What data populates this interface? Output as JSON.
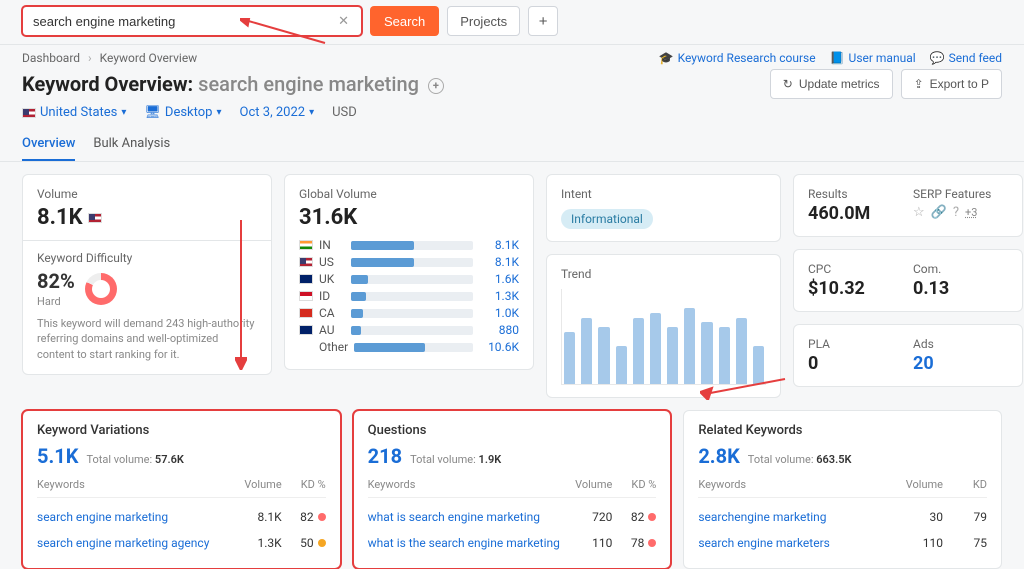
{
  "search": {
    "value": "search engine marketing",
    "button": "Search",
    "projects": "Projects"
  },
  "breadcrumb": [
    "Dashboard",
    "Keyword Overview"
  ],
  "headerLinks": {
    "course": "Keyword Research course",
    "manual": "User manual",
    "feedback": "Send feed"
  },
  "title": {
    "prefix": "Keyword Overview:",
    "keyword": "search engine marketing"
  },
  "actions": {
    "update": "Update metrics",
    "export": "Export to P"
  },
  "filters": {
    "country": "United States",
    "device": "Desktop",
    "date": "Oct 3, 2022",
    "currency": "USD"
  },
  "tabs": [
    "Overview",
    "Bulk Analysis"
  ],
  "volume": {
    "label": "Volume",
    "value": "8.1K"
  },
  "kd": {
    "label": "Keyword Difficulty",
    "value": "82%",
    "level": "Hard",
    "note": "This keyword will demand 243 high-authority referring domains and well-optimized content to start ranking for it."
  },
  "globalVolume": {
    "label": "Global Volume",
    "value": "31.6K",
    "rows": [
      {
        "flag": "in",
        "cc": "IN",
        "pct": 52,
        "val": "8.1K"
      },
      {
        "flag": "us",
        "cc": "US",
        "pct": 52,
        "val": "8.1K"
      },
      {
        "flag": "uk",
        "cc": "UK",
        "pct": 14,
        "val": "1.6K"
      },
      {
        "flag": "id",
        "cc": "ID",
        "pct": 12,
        "val": "1.3K"
      },
      {
        "flag": "ca",
        "cc": "CA",
        "pct": 10,
        "val": "1.0K"
      },
      {
        "flag": "au",
        "cc": "AU",
        "pct": 8,
        "val": "880"
      }
    ],
    "other": {
      "cc": "Other",
      "pct": 60,
      "val": "10.6K"
    }
  },
  "intent": {
    "label": "Intent",
    "badge": "Informational"
  },
  "trend": {
    "label": "Trend",
    "bars": [
      55,
      70,
      60,
      40,
      70,
      75,
      60,
      80,
      65,
      60,
      70,
      40
    ]
  },
  "results": {
    "label": "Results",
    "value": "460.0M"
  },
  "serp": {
    "label": "SERP Features",
    "more": "+3"
  },
  "cpc": {
    "label": "CPC",
    "value": "$10.32"
  },
  "com": {
    "label": "Com.",
    "value": "0.13"
  },
  "pla": {
    "label": "PLA",
    "value": "0"
  },
  "ads": {
    "label": "Ads",
    "value": "20"
  },
  "variations": {
    "title": "Keyword Variations",
    "count": "5.1K",
    "tvLabel": "Total volume:",
    "tv": "57.6K",
    "cols": [
      "Keywords",
      "Volume",
      "KD %"
    ],
    "rows": [
      {
        "kw": "search engine marketing",
        "vol": "8.1K",
        "kd": "82",
        "dot": "#ff6b6b"
      },
      {
        "kw": "search engine marketing agency",
        "vol": "1.3K",
        "kd": "50",
        "dot": "#f5a623"
      }
    ]
  },
  "questions": {
    "title": "Questions",
    "count": "218",
    "tvLabel": "Total volume:",
    "tv": "1.9K",
    "cols": [
      "Keywords",
      "Volume",
      "KD %"
    ],
    "rows": [
      {
        "kw": "what is search engine marketing",
        "vol": "720",
        "kd": "82",
        "dot": "#ff6b6b"
      },
      {
        "kw": "what is the search engine marketing",
        "vol": "110",
        "kd": "78",
        "dot": "#ff6b6b"
      }
    ]
  },
  "related": {
    "title": "Related Keywords",
    "count": "2.8K",
    "tvLabel": "Total volume:",
    "tv": "663.5K",
    "cols": [
      "Keywords",
      "Volume",
      "KD"
    ],
    "rows": [
      {
        "kw": "searchengine marketing",
        "vol": "30",
        "kd": "79"
      },
      {
        "kw": "search engine marketers",
        "vol": "110",
        "kd": "75"
      }
    ]
  },
  "chart_data": {
    "type": "bar",
    "title": "Trend",
    "categories": [
      "1",
      "2",
      "3",
      "4",
      "5",
      "6",
      "7",
      "8",
      "9",
      "10",
      "11",
      "12"
    ],
    "values": [
      55,
      70,
      60,
      40,
      70,
      75,
      60,
      80,
      65,
      60,
      70,
      40
    ],
    "ylim": [
      0,
      100
    ],
    "xlabel": "",
    "ylabel": ""
  }
}
